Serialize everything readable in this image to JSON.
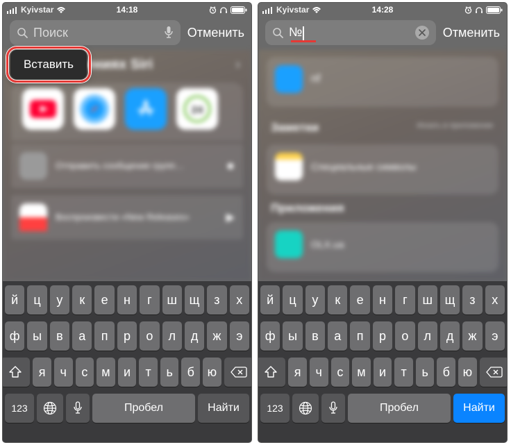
{
  "left": {
    "status": {
      "carrier": "Kyivstar",
      "time": "14:18",
      "icons": [
        "alarm",
        "headphones",
        "battery"
      ]
    },
    "search": {
      "placeholder": "Поиск",
      "value": "",
      "showMic": true
    },
    "cancel": "Отменить",
    "paste": {
      "label": "Вставить"
    },
    "siri": {
      "heading": "жениях Siri"
    },
    "apps": [
      {
        "name": "YouTube",
        "color": "#ffffff",
        "mark": "#ff0033"
      },
      {
        "name": "Safari",
        "color": "#ffffff"
      },
      {
        "name": "App Store",
        "color": "#1aa0ff"
      },
      {
        "name": "Privat24",
        "color": "#ffffff"
      }
    ],
    "suggestions": [
      {
        "title": "Отправить сообщение групп…",
        "sub": "",
        "icon": "#a0a0a0",
        "right": "bubble"
      },
      {
        "title": "Воспроизвести «New Releases»",
        "sub": "",
        "icon": "#ff4040",
        "right": "play"
      }
    ],
    "keyboard": {
      "rows": [
        [
          "й",
          "ц",
          "у",
          "к",
          "е",
          "н",
          "г",
          "ш",
          "щ",
          "з",
          "х"
        ],
        [
          "ф",
          "ы",
          "в",
          "а",
          "п",
          "р",
          "о",
          "л",
          "д",
          "ж",
          "э"
        ],
        [
          "я",
          "ч",
          "с",
          "м",
          "и",
          "т",
          "ь",
          "б",
          "ю"
        ]
      ],
      "num": "123",
      "space": "Пробел",
      "return": "Найти",
      "returnActive": false
    }
  },
  "right": {
    "status": {
      "carrier": "Kyivstar",
      "time": "14:28",
      "icons": [
        "alarm",
        "headphones",
        "battery"
      ]
    },
    "search": {
      "placeholder": "Поиск",
      "value": "№",
      "showClear": true
    },
    "cancel": "Отменить",
    "sections": {
      "top": {
        "label": "nf",
        "iconColor": "#1aa0ff"
      },
      "notes": {
        "title": "Заметки",
        "hint": "Искать в приложении",
        "item": "Специальные символы"
      },
      "apps": {
        "title": "Приложения",
        "item": "OLX.ua",
        "iconColor": "#17d3c3"
      }
    },
    "keyboard": {
      "rows": [
        [
          "й",
          "ц",
          "у",
          "к",
          "е",
          "н",
          "г",
          "ш",
          "щ",
          "з",
          "х"
        ],
        [
          "ф",
          "ы",
          "в",
          "а",
          "п",
          "р",
          "о",
          "л",
          "д",
          "ж",
          "э"
        ],
        [
          "я",
          "ч",
          "с",
          "м",
          "и",
          "т",
          "ь",
          "б",
          "ю"
        ]
      ],
      "num": "123",
      "space": "Пробел",
      "return": "Найти",
      "returnActive": true
    }
  }
}
